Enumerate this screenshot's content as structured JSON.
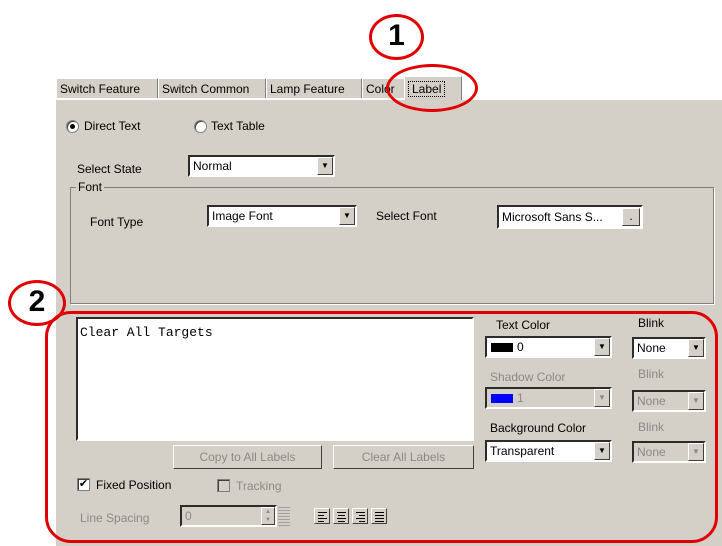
{
  "tabs": [
    "Switch Feature",
    "Switch Common",
    "Lamp Feature",
    "Color",
    "Label"
  ],
  "source": {
    "direct_text": "Direct Text",
    "text_table": "Text Table",
    "selected": "Direct Text"
  },
  "select_state": {
    "label": "Select State",
    "value": "Normal"
  },
  "font_group": {
    "title": "Font",
    "font_type_label": "Font Type",
    "font_type_value": "Image Font",
    "select_font_label": "Select Font",
    "select_font_value": "Microsoft  Sans S...",
    "browse_button": "."
  },
  "label_text": "Clear All Targets",
  "buttons": {
    "copy_all": "Copy to All Labels",
    "clear_all": "Clear All Labels"
  },
  "text_color": {
    "label": "Text Color",
    "value": "0",
    "swatch": "#000000"
  },
  "shadow_color": {
    "label": "Shadow Color",
    "value": "1",
    "swatch": "#0000ff"
  },
  "background_color": {
    "label": "Background Color",
    "value": "Transparent"
  },
  "blink": {
    "label": "Blink",
    "text_value": "None",
    "shadow_value": "None",
    "bg_value": "None"
  },
  "fixed_position": {
    "label": "Fixed Position",
    "checked": true
  },
  "tracking": {
    "label": "Tracking",
    "checked": false
  },
  "line_spacing": {
    "label": "Line Spacing",
    "value": "0"
  },
  "callouts": {
    "one": "1",
    "two": "2"
  },
  "accent_color": "#e00000"
}
